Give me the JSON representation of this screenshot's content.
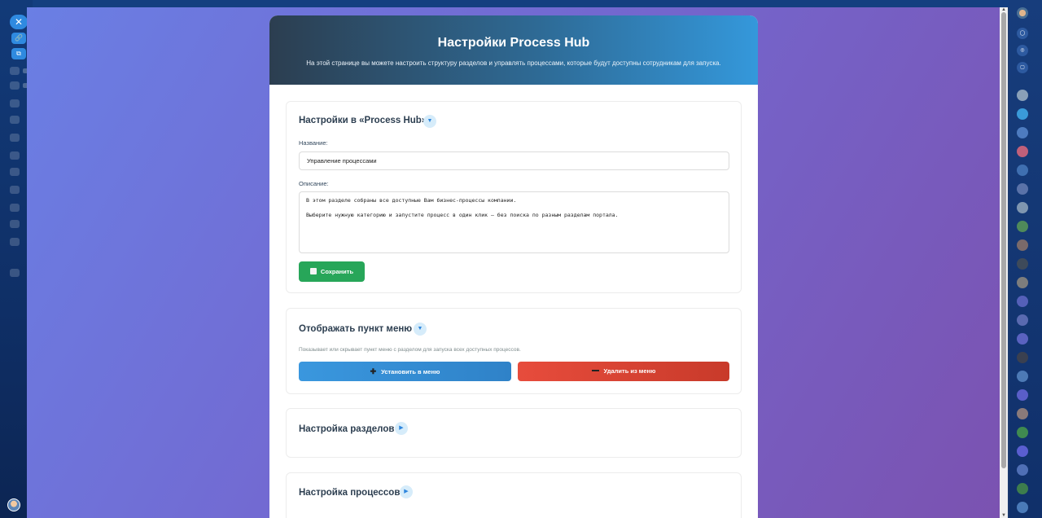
{
  "header": {
    "title": "Настройки Process Hub",
    "subtitle": "На этой странице вы можете настроить структуру разделов и управлять процессами, которые будут доступны сотрудникам для запуска."
  },
  "settings_section": {
    "title": "Настройки в «Process Hub»",
    "toggle_state": "expanded",
    "name_label": "Название:",
    "name_value": "Управление процессами",
    "description_label": "Описание:",
    "description_line1": "В этом разделе собраны все доступные Вам бизнес-процессы компании.",
    "description_line2": "Выберите нужную категорию и запустите процесс в один клик — без поиска по разным разделам портала.",
    "save_label": "Сохранить"
  },
  "menu_section": {
    "title": "Отображать пункт меню",
    "toggle_state": "expanded",
    "description": "Показывает или скрывает пункт меню с разделом для запуска всех доступных процессов.",
    "install_label": "Установить в меню",
    "remove_label": "Удалить из меню"
  },
  "sections_config": {
    "title": "Настройка разделов",
    "toggle_state": "collapsed"
  },
  "processes_config": {
    "title": "Настройка процессов",
    "toggle_state": "collapsed"
  },
  "colors": {
    "save_button": "#27a659",
    "install_button": "#3498db",
    "remove_button": "#e74c3c",
    "header_start": "#2c3e50",
    "header_end": "#3498db"
  }
}
